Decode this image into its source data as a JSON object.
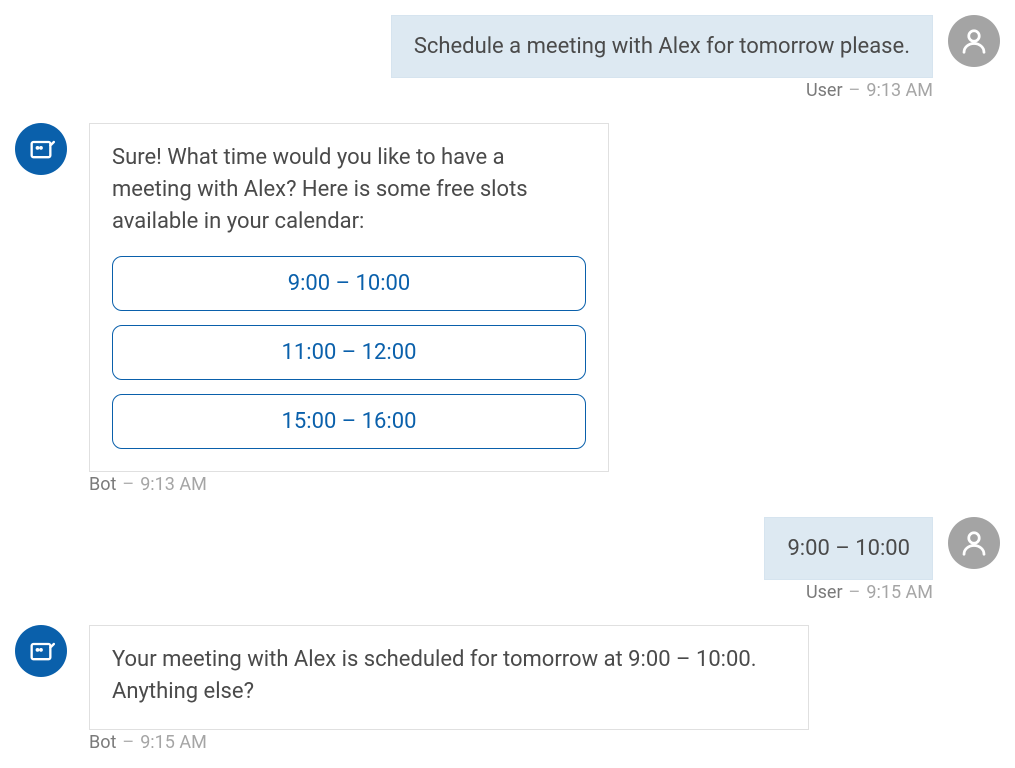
{
  "messages": {
    "user1": {
      "text": "Schedule a meeting with Alex for tomorrow please.",
      "sender": "User",
      "time": "9:13 AM"
    },
    "bot1": {
      "text": "Sure! What time would you like to have a meeting with Alex? Here is some free slots available in your calendar:",
      "options": {
        "opt1": "9:00 – 10:00",
        "opt2": "11:00 – 12:00",
        "opt3": "15:00 – 16:00"
      },
      "sender": "Bot",
      "time": "9:13 AM"
    },
    "user2": {
      "text": "9:00 – 10:00",
      "sender": "User",
      "time": "9:15 AM"
    },
    "bot2": {
      "text": "Your meeting with Alex is scheduled for tomorrow at 9:00 – 10:00. Anything else?",
      "sender": "Bot",
      "time": "9:15 AM"
    }
  },
  "separator": "–"
}
